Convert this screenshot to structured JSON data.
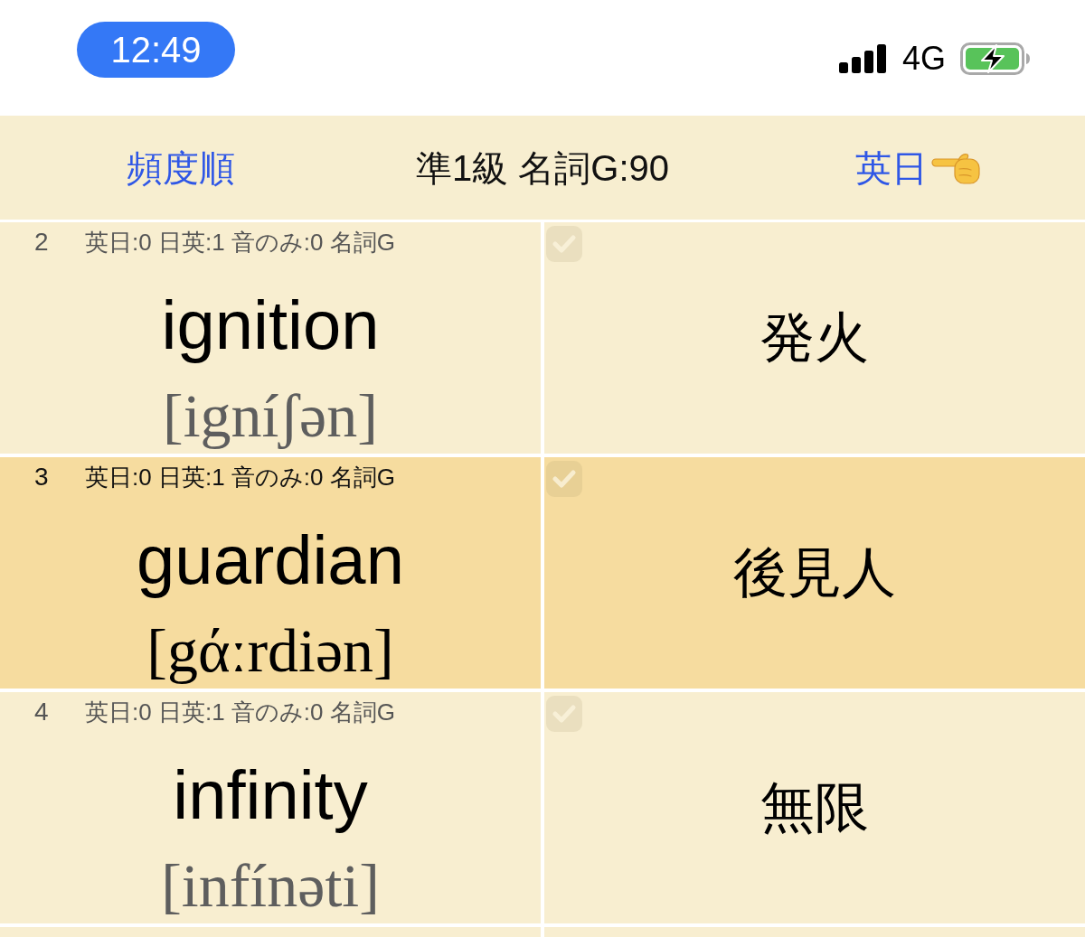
{
  "status_bar": {
    "time": "12:49",
    "network": "4G"
  },
  "nav_bar": {
    "left_button": "頻度順",
    "title": "準1級 名詞G:90",
    "right_button": "英日"
  },
  "rows": [
    {
      "number": "2",
      "stats": "英日:0 日英:1 音のみ:0 名詞G",
      "word": "ignition",
      "pronunciation": "[igníʃən]",
      "meaning": "発火",
      "selected": false,
      "checked": false
    },
    {
      "number": "3",
      "stats": "英日:0 日英:1 音のみ:0 名詞G",
      "word": "guardian",
      "pronunciation": "[gάːrdiən]",
      "meaning": "後見人",
      "selected": true,
      "checked": false
    },
    {
      "number": "4",
      "stats": "英日:0 日英:1 音のみ:0 名詞G",
      "word": "infinity",
      "pronunciation": "[infínəti]",
      "meaning": "無限",
      "selected": false,
      "checked": false
    }
  ]
}
